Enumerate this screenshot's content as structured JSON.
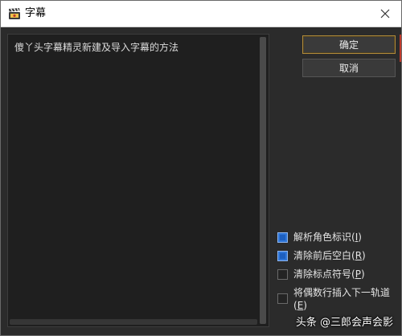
{
  "window": {
    "title": "字幕",
    "close_icon": "close-icon",
    "app_icon": "clapperboard-icon"
  },
  "content": {
    "text": "傻丫头字幕精灵新建及导入字幕的方法"
  },
  "buttons": {
    "ok_label": "确定",
    "cancel_label": "取消"
  },
  "options": [
    {
      "label": "解析角色标识",
      "mnemonic": "I",
      "checked": true
    },
    {
      "label": "清除前后空白",
      "mnemonic": "R",
      "checked": true
    },
    {
      "label": "清除标点符号",
      "mnemonic": "P",
      "checked": false
    },
    {
      "label": "将偶数行插入下一轨道",
      "mnemonic": "E",
      "checked": false
    }
  ],
  "watermark": "头条 @三郎会声会影",
  "colors": {
    "checkbox_checked": "#2f76d8",
    "ok_border": "#b08a3a",
    "background": "#2b2b2b"
  }
}
